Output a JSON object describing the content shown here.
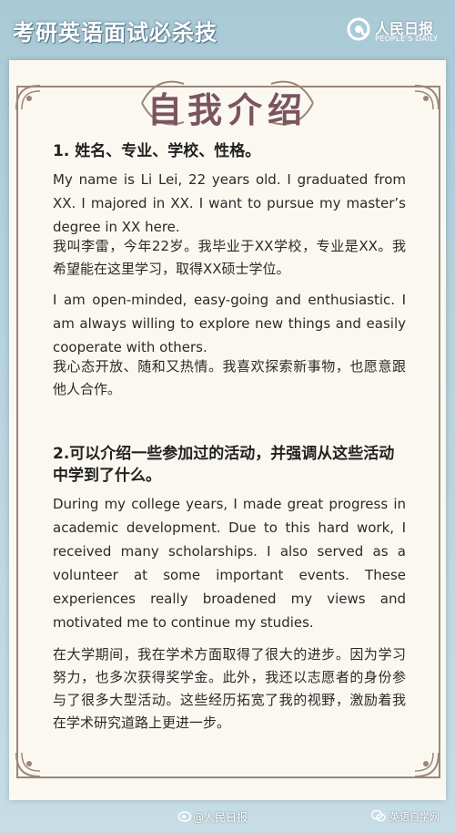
{
  "header": {
    "title": "考研英语面试必杀技",
    "logo_cn": "人民日报",
    "logo_en": "PEOPLE'S DAILY"
  },
  "banner": {
    "title": "自我介绍"
  },
  "sections": [
    {
      "heading": "1. 姓名、专业、学校、性格。",
      "paragraphs": [
        {
          "en": "My name is Li Lei, 22 years old. I graduated from XX. I majored in XX. I want to pursue my master’s degree in XX here.",
          "cn": "我叫李雷，今年22岁。我毕业于XX学校，专业是XX。我希望能在这里学习，取得XX硕士学位。"
        },
        {
          "en": "I am open-minded, easy-going and enthusiastic.  I am always willing to explore new things and easily cooperate with others.",
          "cn": "我心态开放、随和又热情。我喜欢探索新事物，也愿意跟他人合作。"
        }
      ]
    },
    {
      "heading": "2.可以介绍一些参加过的活动，并强调从这些活动中学到了什么。",
      "paragraphs": [
        {
          "en": "During my college years, I made great progress in academic development. Due to this hard work, I received many scholarships. I also served as a volunteer at some important events. These experiences really broadened my views and motivated me to continue my studies.",
          "cn": "在大学期间，我在学术方面取得了很大的进步。因为学习努力，也多次获得奖学金。此外，我还以志愿者的身份参与了很多大型活动。这些经历拓宽了我的视野，激励着我在学术研究道路上更进一步。"
        }
      ]
    }
  ],
  "footer": {
    "watermark_left": "@人民日报",
    "watermark_right": "英语自学网"
  },
  "colors": {
    "background": "#b7d3de",
    "card": "#fbf8f1",
    "frame": "#9a8779",
    "banner_text": "#7a5560"
  }
}
